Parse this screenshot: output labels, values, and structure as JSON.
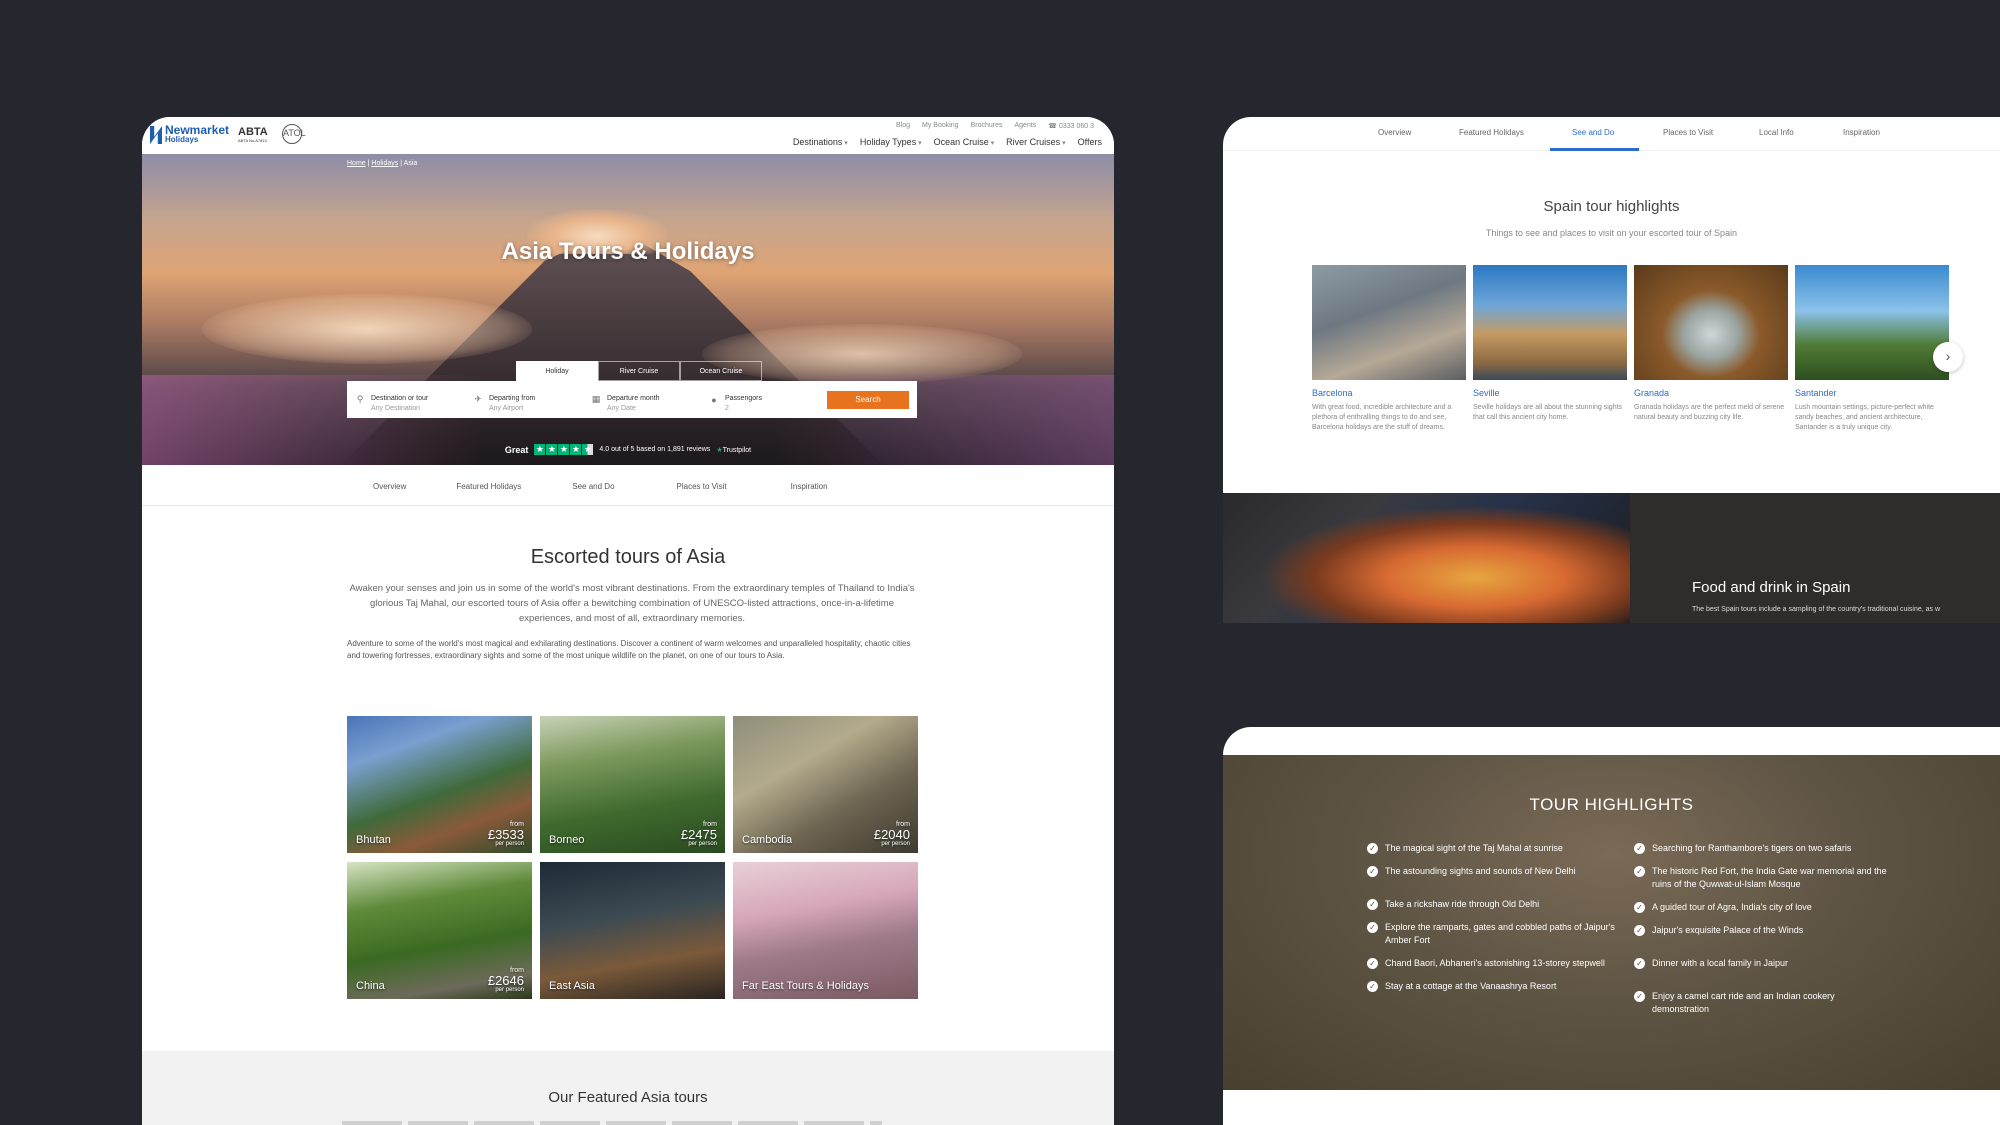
{
  "main": {
    "brand": {
      "name": "Newmarket",
      "sub": "Holidays"
    },
    "abta": {
      "name": "ABTA",
      "sub": "ABTA No.A7810"
    },
    "atol": "ATOL",
    "util_links": [
      "Blog",
      "My Booking",
      "Brochures",
      "Agents",
      "0333 060 3"
    ],
    "nav": [
      "Destinations",
      "Holiday Types",
      "Ocean Cruise",
      "River Cruises",
      "Offers"
    ],
    "breadcrumb": [
      "Home",
      "Holidays",
      "Asia"
    ],
    "hero_title": "Asia Tours & Holidays",
    "search_tabs": [
      "Holiday",
      "River Cruise",
      "Ocean Cruise"
    ],
    "search_fields": [
      {
        "icon": "map-pin-icon",
        "label": "Destination or tour",
        "value": "Any Destination"
      },
      {
        "icon": "plane-icon",
        "label": "Departing from",
        "value": "Any Airport"
      },
      {
        "icon": "calendar-icon",
        "label": "Departure month",
        "value": "Any Date"
      },
      {
        "icon": "person-icon",
        "label": "Passengors",
        "value": "2"
      }
    ],
    "search_button": "Search",
    "trustpilot": {
      "rating_word": "Great",
      "score_text": "4.0 out of 5 based on 1,891 reviews",
      "brand": "Trustpilot",
      "stars": 4.5
    },
    "subnav": [
      "Overview",
      "Featured Holidays",
      "See and Do",
      "Places to Visit",
      "Inspiration"
    ],
    "escorted_title": "Escorted tours of Asia",
    "escorted_intro": "Awaken your senses and join us in some of the world's most vibrant destinations. From the extraordinary temples of Thailand to India's glorious Taj Mahal, our escorted tours of Asia offer a bewitching combination of UNESCO-listed attractions, once-in-a-lifetime experiences, and most of all, extraordinary memories.",
    "escorted_body": "Adventure to some of the world's most magical and exhilarating destinations. Discover a continent of warm welcomes and unparalleled hospitality, chaotic cities and towering fortresses, extraordinary sights and some of the most unique wildlife on the planet, on one of our tours to Asia.",
    "tiles": [
      {
        "name": "Bhutan",
        "from": "from",
        "price": "£3533",
        "per": "per person"
      },
      {
        "name": "Borneo",
        "from": "from",
        "price": "£2475",
        "per": "per person"
      },
      {
        "name": "Cambodia",
        "from": "from",
        "price": "£2040",
        "per": "per person"
      },
      {
        "name": "China",
        "from": "from",
        "price": "£2646",
        "per": "per person"
      },
      {
        "name": "East Asia",
        "from": "",
        "price": "",
        "per": ""
      },
      {
        "name": "Far East Tours & Holidays",
        "from": "",
        "price": "",
        "per": ""
      }
    ],
    "featured_title": "Our Featured Asia tours"
  },
  "spain": {
    "tabs": [
      "Overview",
      "Featured Holidays",
      "See and Do",
      "Places to Visit",
      "Local Info",
      "Inspiration"
    ],
    "active_tab": "See and Do",
    "title": "Spain tour highlights",
    "subtitle": "Things to see and places to visit on your escorted tour of Spain",
    "cards": [
      {
        "name": "Barcelona",
        "desc": "With great food, incredible architecture and a plethora of enthralling things to do and see, Barcelona holidays are the stuff of dreams."
      },
      {
        "name": "Seville",
        "desc": "Seville holidays are all about the stunning sights that call this ancient city home."
      },
      {
        "name": "Granada",
        "desc": "Granada holidays are the perfect meld of serene natural beauty and buzzing city life."
      },
      {
        "name": "Santander",
        "desc": "Lush mountain settings, picture-perfect white sandy beaches, and ancient architecture, Santander is a truly unique city."
      }
    ],
    "food_title": "Food and drink in Spain",
    "food_sub": "The best Spain tours include a sampling of the country's traditional cuisine, as w"
  },
  "tour": {
    "title": "TOUR HIGHLIGHTS",
    "left": [
      "The magical sight of the Taj Mahal at sunrise",
      "The astounding sights and sounds of New Delhi",
      "Take a rickshaw ride through Old Delhi",
      "Explore the ramparts, gates and cobbled paths of Jaipur's Amber Fort",
      "Chand Baori, Abhaneri's astonishing 13-storey stepwell",
      "Stay at a cottage at the Vanaashrya Resort"
    ],
    "right": [
      "Searching for Ranthambore's tigers on two safaris",
      "The historic Red Fort, the India Gate war memorial and the ruins of the Quwwat-ul-Islam Mosque",
      "A guided tour of Agra, India's city of love",
      "Jaipur's exquisite Palace of the Winds",
      "Dinner with a local family in Jaipur",
      "Enjoy a camel cart ride and an Indian cookery demonstration"
    ]
  },
  "colors": {
    "background": "#26262f",
    "brand_blue": "#1f5db0",
    "accent_orange": "#e8731f",
    "link_blue": "#2a6ccb",
    "trust_green": "#00b67a"
  }
}
